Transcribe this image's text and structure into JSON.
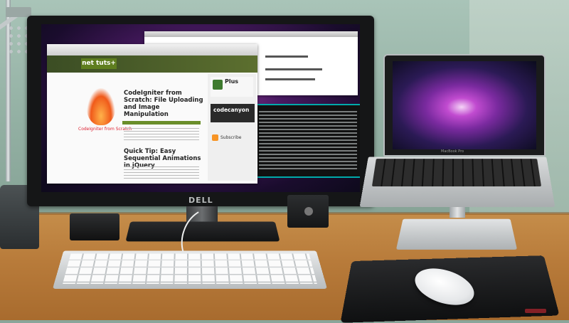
{
  "scene": {
    "description_free": true,
    "monitor": {
      "brand_label": "DELL",
      "screen": {
        "site_logo": "net tuts+",
        "article_1_title": "CodeIgniter from Scratch: File Uploading and Image Manipulation",
        "article_2_title": "Quick Tip: Easy Sequential Animations in jQuery",
        "flame_caption": "CodeIgniter from Scratch",
        "plus_label": "Plus",
        "codecanyon_label": "codecanyon",
        "subscribe_label": "Subscribe"
      }
    },
    "laptop": {
      "brand_label": "MacBook Pro"
    },
    "colors": {
      "wall": "#93b0a3",
      "desk": "#b87b3a",
      "monitor_bezel": "#151617",
      "wallpaper_purple": "#7a2a9f",
      "nettuts_green": "#5f7e1f"
    },
    "icons": [
      "plus-icon",
      "rss-icon",
      "flame-logo-icon"
    ]
  }
}
